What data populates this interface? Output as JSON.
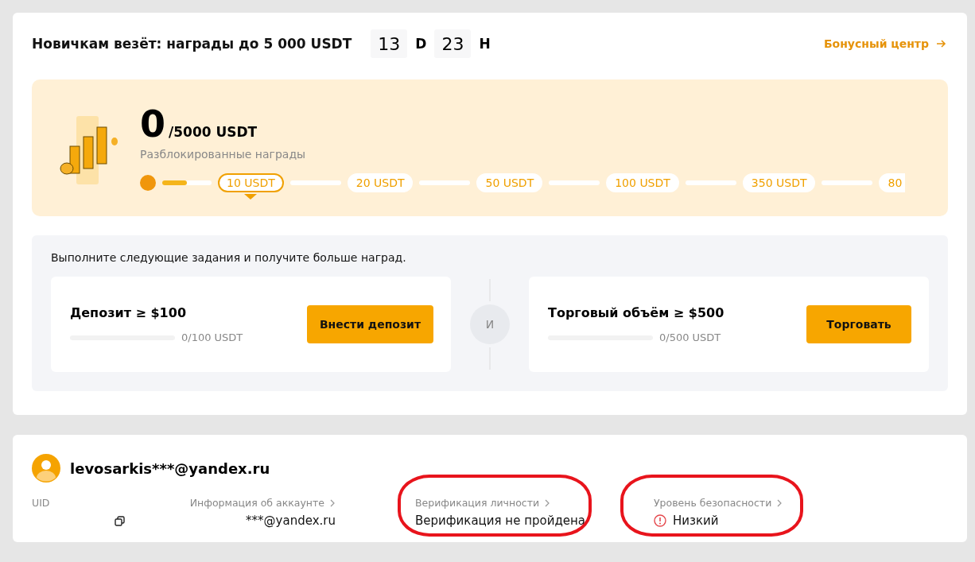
{
  "promo": {
    "title": "Новичкам везёт: награды до 5 000 USDT",
    "countdown": [
      {
        "value": "13",
        "unit": "D"
      },
      {
        "value": "23",
        "unit": "H"
      }
    ],
    "link": "Бонусный центр"
  },
  "rewards": {
    "amount": "0",
    "total": "/5000 USDT",
    "caption": "Разблокированные награды",
    "level": 0.5,
    "milestones": [
      {
        "label": "10 USDT",
        "selected": true
      },
      {
        "label": "20 USDT",
        "selected": false
      },
      {
        "label": "50 USDT",
        "selected": false
      },
      {
        "label": "100 USDT",
        "selected": false
      },
      {
        "label": "350 USDT",
        "selected": false
      },
      {
        "label": "80",
        "selected": false
      }
    ]
  },
  "tasks": {
    "intro": "Выполните следующие задания и получите больше наград.",
    "joiner": "И",
    "items": [
      {
        "title": "Депозит ≥ $100",
        "level": 0,
        "reading": "0/100 USDT",
        "button": "Внести депозит"
      },
      {
        "title": "Торговый объём ≥ $500",
        "level": 0,
        "reading": "0/500 USDT",
        "button": "Торговать"
      }
    ]
  },
  "account": {
    "email": "levosarkis***@yandex.ru",
    "fields": [
      {
        "kind": "uid",
        "label": "UID",
        "highlighted": false
      },
      {
        "kind": "link",
        "label": "Информация об аккаунте",
        "value": "***@yandex.ru",
        "highlighted": false
      },
      {
        "kind": "link",
        "label": "Верификация личности",
        "value": "Верификация не пройдена",
        "highlighted": true
      },
      {
        "kind": "warning",
        "label": "Уровень безопасности",
        "value": "Низкий",
        "highlighted": true
      }
    ]
  }
}
